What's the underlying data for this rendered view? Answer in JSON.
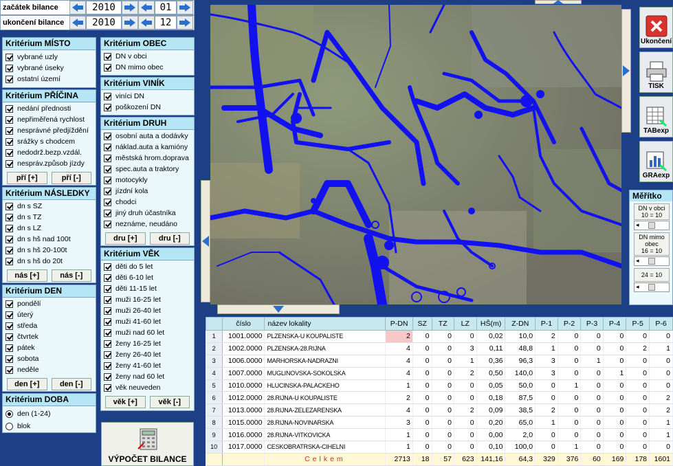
{
  "period": {
    "start_label": "začátek bilance",
    "start_year": "2010",
    "start_month": "01",
    "end_label": "ukončení bilance",
    "end_year": "2010",
    "end_month": "12"
  },
  "misto": {
    "title": "Kritérium MÍSTO",
    "items": [
      "vybrané uzly",
      "vybrané úseky",
      "ostatní území"
    ]
  },
  "pricina": {
    "title": "Kritérium PŘÍČINA",
    "items": [
      "nedání přednosti",
      "nepřiměřená rychlost",
      "nesprávné předjíždění",
      "srážky s chodcem",
      "nedodrž.bezp.vzdál.",
      "nespráv.způsob jízdy"
    ],
    "plus": "pří [+]",
    "minus": "pří [-]"
  },
  "nasledky": {
    "title": "Kritérium NÁSLEDKY",
    "items": [
      "dn s SZ",
      "dn s TZ",
      "dn s LZ",
      "dn s hš nad 100t",
      "dn s hš 20-100t",
      "dn s hš do 20t"
    ],
    "plus": "nás [+]",
    "minus": "nás [-]"
  },
  "den": {
    "title": "Kritérium DEN",
    "items": [
      "pondělí",
      "úterý",
      "středa",
      "čtvrtek",
      "pátek",
      "sobota",
      "neděle"
    ],
    "plus": "den [+]",
    "minus": "den [-]"
  },
  "doba": {
    "title": "Kritérium DOBA",
    "items": [
      "den (1-24)",
      "blok"
    ]
  },
  "obec": {
    "title": "Kritérium OBEC",
    "items": [
      "DN v obci",
      "DN mimo obec"
    ]
  },
  "vinik": {
    "title": "Kritérium VINÍK",
    "items": [
      "viníci DN",
      "poškození DN"
    ]
  },
  "druh": {
    "title": "Kritérium DRUH",
    "items": [
      "osobní auta a dodávky",
      "náklad.auta a kamióny",
      "městská hrom.doprava",
      "spec.auta a traktory",
      "motocykly",
      "jízdní kola",
      "chodci",
      "jiný druh účastníka",
      "neznáme, neudáno"
    ],
    "plus": "dru [+]",
    "minus": "dru [-]"
  },
  "vek": {
    "title": "Kritérium VĚK",
    "items": [
      "děti do 5 let",
      "děti 6-10 let",
      "děti 11-15 let",
      "muži 16-25 let",
      "muži 26-40 let",
      "muži 41-60 let",
      "muži nad 60 let",
      "ženy 16-25 let",
      "ženy 26-40 let",
      "ženy 41-60 let",
      "ženy nad 60 let",
      "věk neuveden"
    ],
    "plus": "věk [+]",
    "minus": "věk [-]"
  },
  "calc_label": "VÝPOČET BILANCE",
  "tools": {
    "exit": "Ukončení",
    "print": "TISK",
    "tab": "TABexp",
    "gra": "GRAexp"
  },
  "scale": {
    "title": "Měřítko",
    "boxes": [
      {
        "l1": "DN v obci",
        "l2": "10 = 10"
      },
      {
        "l1": "DN mimo obec",
        "l2": "16 = 10"
      },
      {
        "l1": "",
        "l2": "24 = 10"
      }
    ]
  },
  "table": {
    "headers": [
      "číslo",
      "název lokality",
      "P-DN",
      "SZ",
      "TZ",
      "LZ",
      "HŠ(m)",
      "Z-DN",
      "P-1",
      "P-2",
      "P-3",
      "P-4",
      "P-5",
      "P-6"
    ],
    "rows": [
      [
        "1",
        "1001.0000",
        "PLZENSKA-U KOUPALISTE",
        "2",
        "0",
        "0",
        "0",
        "0,02",
        "10,0",
        "2",
        "0",
        "0",
        "0",
        "0",
        "0"
      ],
      [
        "2",
        "1002.0000",
        "PLZENSKA-28.RIJNA",
        "4",
        "0",
        "0",
        "3",
        "0,11",
        "48,8",
        "1",
        "0",
        "0",
        "0",
        "2",
        "1"
      ],
      [
        "3",
        "1006.0000",
        "MARHORSKA-NADRAZNI",
        "4",
        "0",
        "0",
        "1",
        "0,36",
        "96,3",
        "3",
        "0",
        "1",
        "0",
        "0",
        "0"
      ],
      [
        "4",
        "1007.0000",
        "MUGLINOVSKA-SOKOLSKA",
        "4",
        "0",
        "0",
        "2",
        "0,50",
        "140,0",
        "3",
        "0",
        "0",
        "1",
        "0",
        "0"
      ],
      [
        "5",
        "1010.0000",
        "HLUCINSKA-PALACKEHO",
        "1",
        "0",
        "0",
        "0",
        "0,05",
        "50,0",
        "0",
        "1",
        "0",
        "0",
        "0",
        "0"
      ],
      [
        "6",
        "1012.0000",
        "28.RIJNA-U KOUPALISTE",
        "2",
        "0",
        "0",
        "0",
        "0,18",
        "87,5",
        "0",
        "0",
        "0",
        "0",
        "0",
        "2"
      ],
      [
        "7",
        "1013.0000",
        "28.RIJNA-ZELEZARENSKA",
        "4",
        "0",
        "0",
        "2",
        "0,09",
        "38,5",
        "2",
        "0",
        "0",
        "0",
        "0",
        "2"
      ],
      [
        "8",
        "1015.0000",
        "28.RIJNA-NOVINARSKA",
        "3",
        "0",
        "0",
        "0",
        "0,20",
        "65,0",
        "1",
        "0",
        "0",
        "0",
        "0",
        "1"
      ],
      [
        "9",
        "1016.0000",
        "28.RIJNA-VITKOVICKA",
        "1",
        "0",
        "0",
        "0",
        "0,00",
        "2,0",
        "0",
        "0",
        "0",
        "0",
        "0",
        "1"
      ],
      [
        "10",
        "1017.0000",
        "CESKOBRATRSKA-CIHELNI",
        "1",
        "0",
        "0",
        "0",
        "0,10",
        "100,0",
        "0",
        "1",
        "0",
        "0",
        "0",
        "0"
      ]
    ],
    "total_label": "Celkem",
    "totals": [
      "2713",
      "18",
      "57",
      "623",
      "141,16",
      "64,3",
      "329",
      "376",
      "60",
      "169",
      "178",
      "1601"
    ]
  }
}
